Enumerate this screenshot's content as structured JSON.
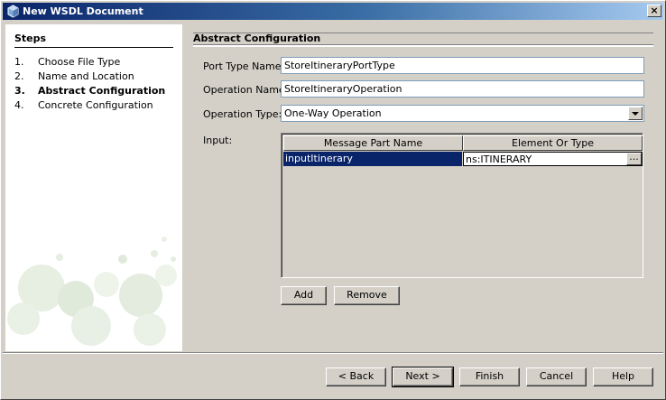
{
  "window": {
    "title": "New WSDL Document",
    "close_label": "×"
  },
  "steps": {
    "heading": "Steps",
    "items": [
      {
        "num": "1.",
        "label": "Choose File Type"
      },
      {
        "num": "2.",
        "label": "Name and Location"
      },
      {
        "num": "3.",
        "label": "Abstract Configuration"
      },
      {
        "num": "4.",
        "label": "Concrete Configuration"
      }
    ]
  },
  "content": {
    "title": "Abstract Configuration",
    "port_type": {
      "label": "Port Type Name:",
      "value": "StoreItineraryPortType"
    },
    "operation_name": {
      "label": "Operation Name:",
      "value": "StoreItineraryOperation"
    },
    "operation_type": {
      "label": "Operation Type:",
      "value": "One-Way Operation"
    },
    "input": {
      "label": "Input:",
      "columns": [
        "Message Part Name",
        "Element Or Type"
      ],
      "rows": [
        {
          "name": "inputItinerary",
          "type": "ns:ITINERARY"
        }
      ],
      "ellipsis": "..."
    },
    "add_label": "Add",
    "remove_label": "Remove"
  },
  "footer": {
    "back_label": "< Back",
    "next_label": "Next >",
    "finish_label": "Finish",
    "cancel_label": "Cancel",
    "help_label": "Help"
  }
}
